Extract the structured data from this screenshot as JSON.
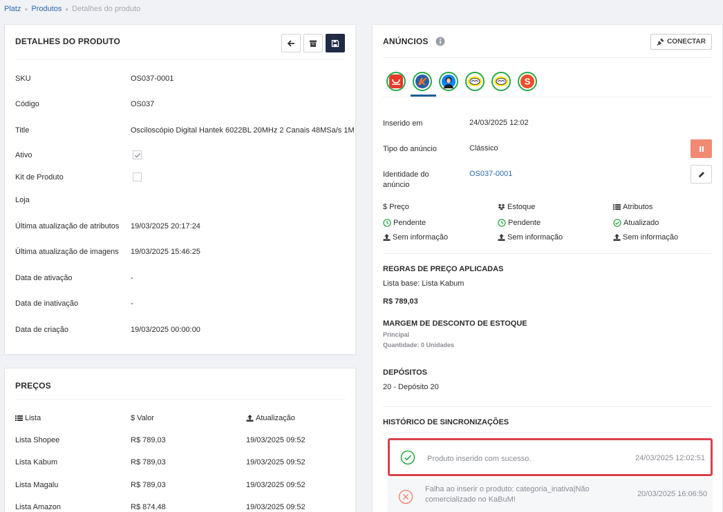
{
  "breadcrumb": [
    "Platz",
    "Produtos",
    "Detalhes do produto"
  ],
  "detail": {
    "title": "DETALHES DO PRODUTO",
    "rows": [
      {
        "label": "SKU",
        "value": "OS037-0001"
      },
      {
        "label": "Código",
        "value": "OS037"
      },
      {
        "label": "Title",
        "value": "Osciloscópio Digital Hantek 6022BL 20MHz 2 Canais 48MSa/s 1M"
      },
      {
        "label": "Ativo",
        "value": ""
      },
      {
        "label": "Kit de Produto",
        "value": ""
      },
      {
        "label": "Loja",
        "value": ""
      },
      {
        "label": "Última atualização de atributos",
        "value": "19/03/2025 20:17:24"
      },
      {
        "label": "Última atualização de imagens",
        "value": "19/03/2025 15:46:25"
      },
      {
        "label": "Data de ativação",
        "value": "-"
      },
      {
        "label": "Data de inativação",
        "value": "-"
      },
      {
        "label": "Data de criação",
        "value": "19/03/2025 00:00:00"
      }
    ],
    "ativo_checked": true,
    "kit_checked": false
  },
  "prices": {
    "title": "PREÇOS",
    "headers": {
      "list": "Lista",
      "value": "$ Valor",
      "updated": "Atualização"
    },
    "rows": [
      {
        "list": "Lista Shopee",
        "value": "R$ 789,03",
        "updated": "19/03/2025 09:52"
      },
      {
        "list": "Lista Kabum",
        "value": "R$ 789,03",
        "updated": "19/03/2025 09:52"
      },
      {
        "list": "Lista Magalu",
        "value": "R$ 789,03",
        "updated": "19/03/2025 09:52"
      },
      {
        "list": "Lista Amazon",
        "value": "R$ 874,48",
        "updated": "19/03/2025 09:52"
      }
    ]
  },
  "ads": {
    "title": "ANÚNCIOS",
    "connect_label": "CONECTAR",
    "channels": [
      "aliexpress",
      "kabum",
      "magalu",
      "mercadolivre-1",
      "mercadolivre-2",
      "shopee"
    ],
    "inserted_label": "Inserido em",
    "inserted_value": "24/03/2025 12:02",
    "type_label": "Tipo do anúncio",
    "type_value": "Clássico",
    "identity_label_1": "Identidade do",
    "identity_label_2": "anúncio",
    "identity_value": "OS037-0001",
    "stats_headers": {
      "price": "Preço",
      "stock": "Estoque",
      "attrs": "Atributos"
    },
    "stats_row1": {
      "price": "Pendente",
      "stock": "Pendente",
      "attrs": "Atualizado"
    },
    "stats_row2": {
      "price": "Sem informação",
      "stock": "Sem informação",
      "attrs": "Sem informação"
    },
    "price_rules_title": "REGRAS DE PREÇO APLICADAS",
    "price_rules_base": "Lista base: Lista Kabum",
    "price_rules_value": "R$ 789,03",
    "stock_margin_title": "MARGEM DE DESCONTO DE ESTOQUE",
    "stock_margin_main": "Principal",
    "stock_margin_qty": "Quantidade: 0 Unidades",
    "deposits_title": "DEPÓSITOS",
    "deposits_value": "20 - Depósito 20",
    "history_title": "HISTÓRICO DE SINCRONIZAÇÕES",
    "history": [
      {
        "message": "Produto inserido com sucesso.",
        "time": "24/03/2025 12:02:51",
        "status": "success"
      },
      {
        "message_1": "Falha ao inserir o produto: categoria_inativa|Não",
        "message_2": "comercializado no KaBuM!",
        "time": "20/03/2025 16:06:50",
        "status": "error"
      }
    ]
  },
  "colors": {
    "accent": "#1f2a44",
    "link": "#2a6ab1",
    "success": "#28a745",
    "error": "#f08a72",
    "highlight": "#d9414a"
  }
}
